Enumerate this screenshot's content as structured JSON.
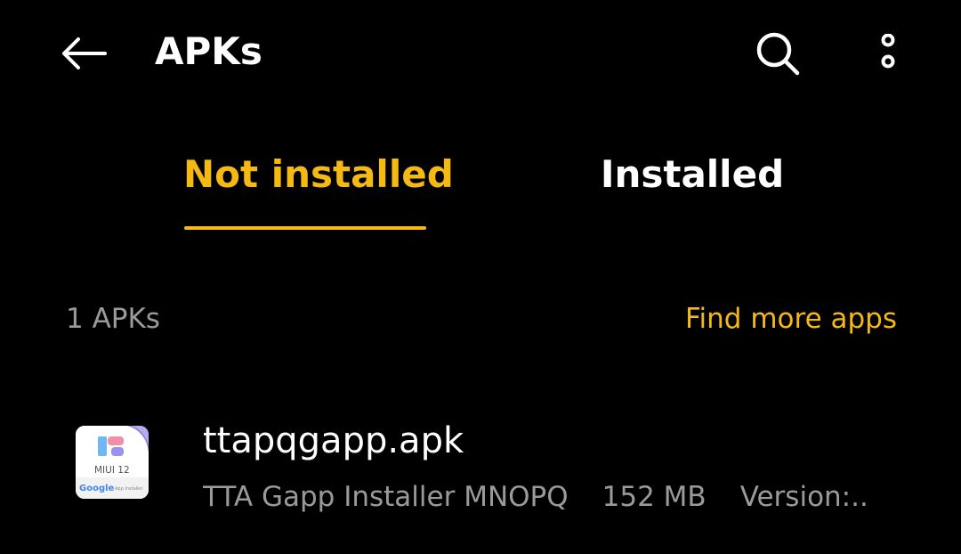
{
  "header": {
    "title": "APKs",
    "back_icon": "arrow-left-icon",
    "search_icon": "search-icon",
    "more_icon": "more-vertical-icon"
  },
  "tabs": [
    {
      "label": "Not installed",
      "selected": true
    },
    {
      "label": "Installed",
      "selected": false
    }
  ],
  "section": {
    "count_label": "1 APKs",
    "find_more_label": "Find more apps"
  },
  "apks": [
    {
      "file_name": "ttapqgapp.apk",
      "app_name": "TTA Gapp Installer MNOPQ",
      "size": "152 MB",
      "version": "Version:..",
      "icon": {
        "name": "miui-12-google-installer-icon",
        "badge_text": "MIUI 12",
        "brand_text": "Google",
        "caption_text": "App Installer"
      }
    }
  ],
  "colors": {
    "background": "#000000",
    "accent": "#f5b914",
    "primary_text": "#ffffff",
    "secondary_text": "#9a9a9a"
  }
}
